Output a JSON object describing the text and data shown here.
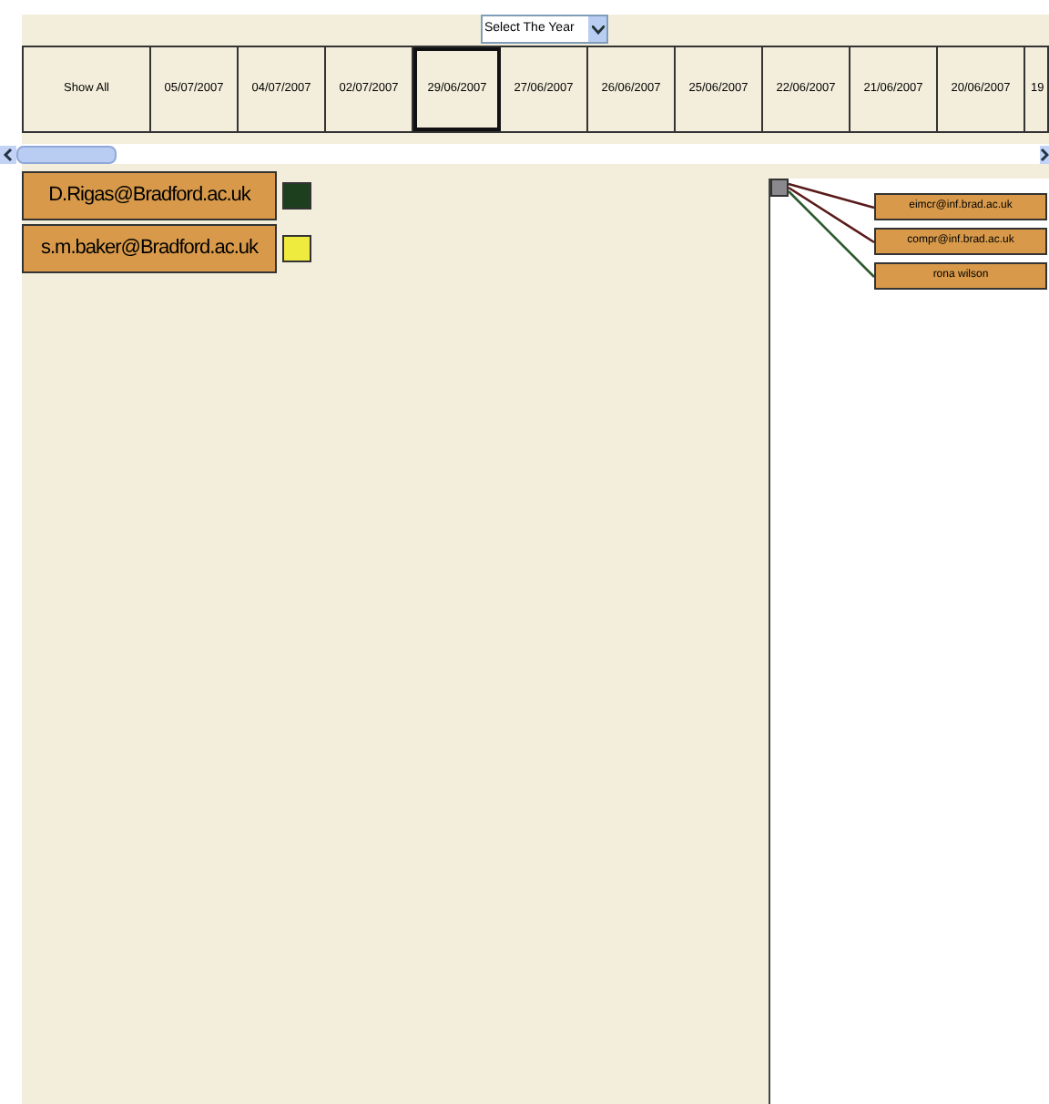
{
  "year_select": {
    "placeholder": "Select The Year"
  },
  "dates": [
    {
      "label": "Show All",
      "selected": false
    },
    {
      "label": "05/07/2007",
      "selected": false
    },
    {
      "label": "04/07/2007",
      "selected": false
    },
    {
      "label": "02/07/2007",
      "selected": false
    },
    {
      "label": "29/06/2007",
      "selected": true
    },
    {
      "label": "27/06/2007",
      "selected": false
    },
    {
      "label": "26/06/2007",
      "selected": false
    },
    {
      "label": "25/06/2007",
      "selected": false
    },
    {
      "label": "22/06/2007",
      "selected": false
    },
    {
      "label": "21/06/2007",
      "selected": false
    },
    {
      "label": "20/06/2007",
      "selected": false
    },
    {
      "label": "19",
      "selected": false
    }
  ],
  "senders": [
    {
      "label": "D.Rigas@Bradford.ac.uk",
      "color": "#1e3f1e"
    },
    {
      "label": "s.m.baker@Bradford.ac.uk",
      "color": "#eeea3e"
    }
  ],
  "recipients": [
    {
      "label": "eimcr@inf.brad.ac.uk",
      "color": "#5a1a1a"
    },
    {
      "label": "compr@inf.brad.ac.uk",
      "color": "#5a1a1a"
    },
    {
      "label": "rona wilson",
      "color": "#2d5a2d"
    }
  ]
}
